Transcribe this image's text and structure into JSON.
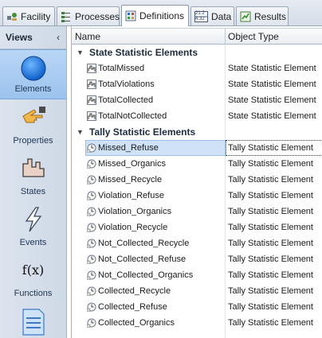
{
  "tabs": [
    {
      "label": "Facility",
      "icon": "facility-icon"
    },
    {
      "label": "Processes",
      "icon": "processes-icon"
    },
    {
      "label": "Definitions",
      "icon": "definitions-icon",
      "active": true
    },
    {
      "label": "Data",
      "icon": "data-table-icon",
      "icon_text_top": "21.2",
      "icon_text_bottom": "4.32"
    },
    {
      "label": "Results",
      "icon": "results-icon"
    }
  ],
  "sidebar": {
    "header": "Views",
    "collapse_glyph": "‹",
    "items": [
      {
        "label": "Elements",
        "icon": "blue-circle-icon",
        "active": true
      },
      {
        "label": "Properties",
        "icon": "pointing-hand-icon"
      },
      {
        "label": "States",
        "icon": "states-icon"
      },
      {
        "label": "Events",
        "icon": "lightning-icon"
      },
      {
        "label": "Functions",
        "icon": "function-icon",
        "icon_text": "f(x)"
      },
      {
        "label": "",
        "icon": "lists-icon"
      }
    ]
  },
  "grid": {
    "columns": [
      "Name",
      "Object Type"
    ],
    "groups": [
      {
        "title": "State Statistic Elements",
        "rows": [
          {
            "name": "TotalMissed",
            "type": "State Statistic Element"
          },
          {
            "name": "TotalViolations",
            "type": "State Statistic Element"
          },
          {
            "name": "TotalCollected",
            "type": "State Statistic Element"
          },
          {
            "name": "TotalNotCollected",
            "type": "State Statistic Element"
          }
        ]
      },
      {
        "title": "Tally Statistic Elements",
        "rows": [
          {
            "name": "Missed_Refuse",
            "type": "Tally Statistic Element",
            "selected": true
          },
          {
            "name": "Missed_Organics",
            "type": "Tally Statistic Element"
          },
          {
            "name": "Missed_Recycle",
            "type": "Tally Statistic Element"
          },
          {
            "name": "Violation_Refuse",
            "type": "Tally Statistic Element"
          },
          {
            "name": "Violation_Organics",
            "type": "Tally Statistic Element"
          },
          {
            "name": "Violation_Recycle",
            "type": "Tally Statistic Element"
          },
          {
            "name": "Not_Collected_Recycle",
            "type": "Tally Statistic Element"
          },
          {
            "name": "Not_Collected_Refuse",
            "type": "Tally Statistic Element"
          },
          {
            "name": "Not_Collected_Organics",
            "type": "Tally Statistic Element"
          },
          {
            "name": "Collected_Recycle",
            "type": "Tally Statistic Element"
          },
          {
            "name": "Collected_Refuse",
            "type": "Tally Statistic Element"
          },
          {
            "name": "Collected_Organics",
            "type": "Tally Statistic Element"
          }
        ]
      }
    ]
  },
  "colors": {
    "selected_nav": "#9cc3ee",
    "selected_row": "#cfe2f7",
    "accent_blue": "#1e6fd6"
  }
}
